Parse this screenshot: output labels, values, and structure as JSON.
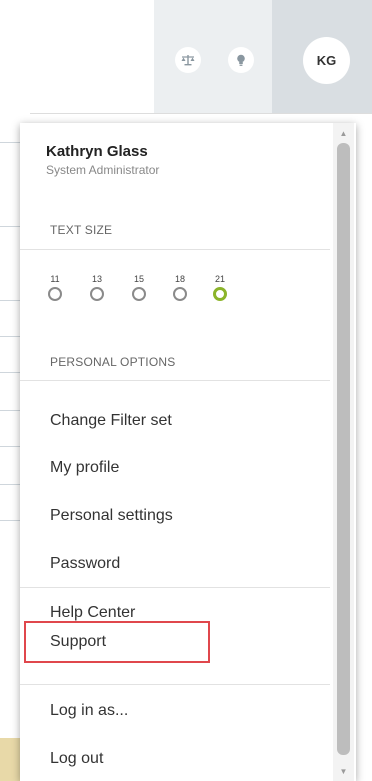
{
  "header": {
    "icons": [
      "scales-icon",
      "lightbulb-icon"
    ],
    "avatar_initials": "KG"
  },
  "menu": {
    "user_name": "Kathryn Glass",
    "user_role": "System Administrator",
    "text_size_label": "TEXT SIZE",
    "text_sizes": [
      "11",
      "13",
      "15",
      "18",
      "21"
    ],
    "text_size_selected": "21",
    "personal_options_label": "PERSONAL OPTIONS",
    "items": {
      "change_filter_set": "Change Filter set",
      "my_profile": "My profile",
      "personal_settings": "Personal settings",
      "password": "Password",
      "help_center": "Help Center",
      "support": "Support",
      "log_in_as": "Log in as...",
      "log_out": "Log out"
    }
  },
  "colors": {
    "selected_radio": "#8bb42a",
    "highlight": "#e0474c"
  }
}
